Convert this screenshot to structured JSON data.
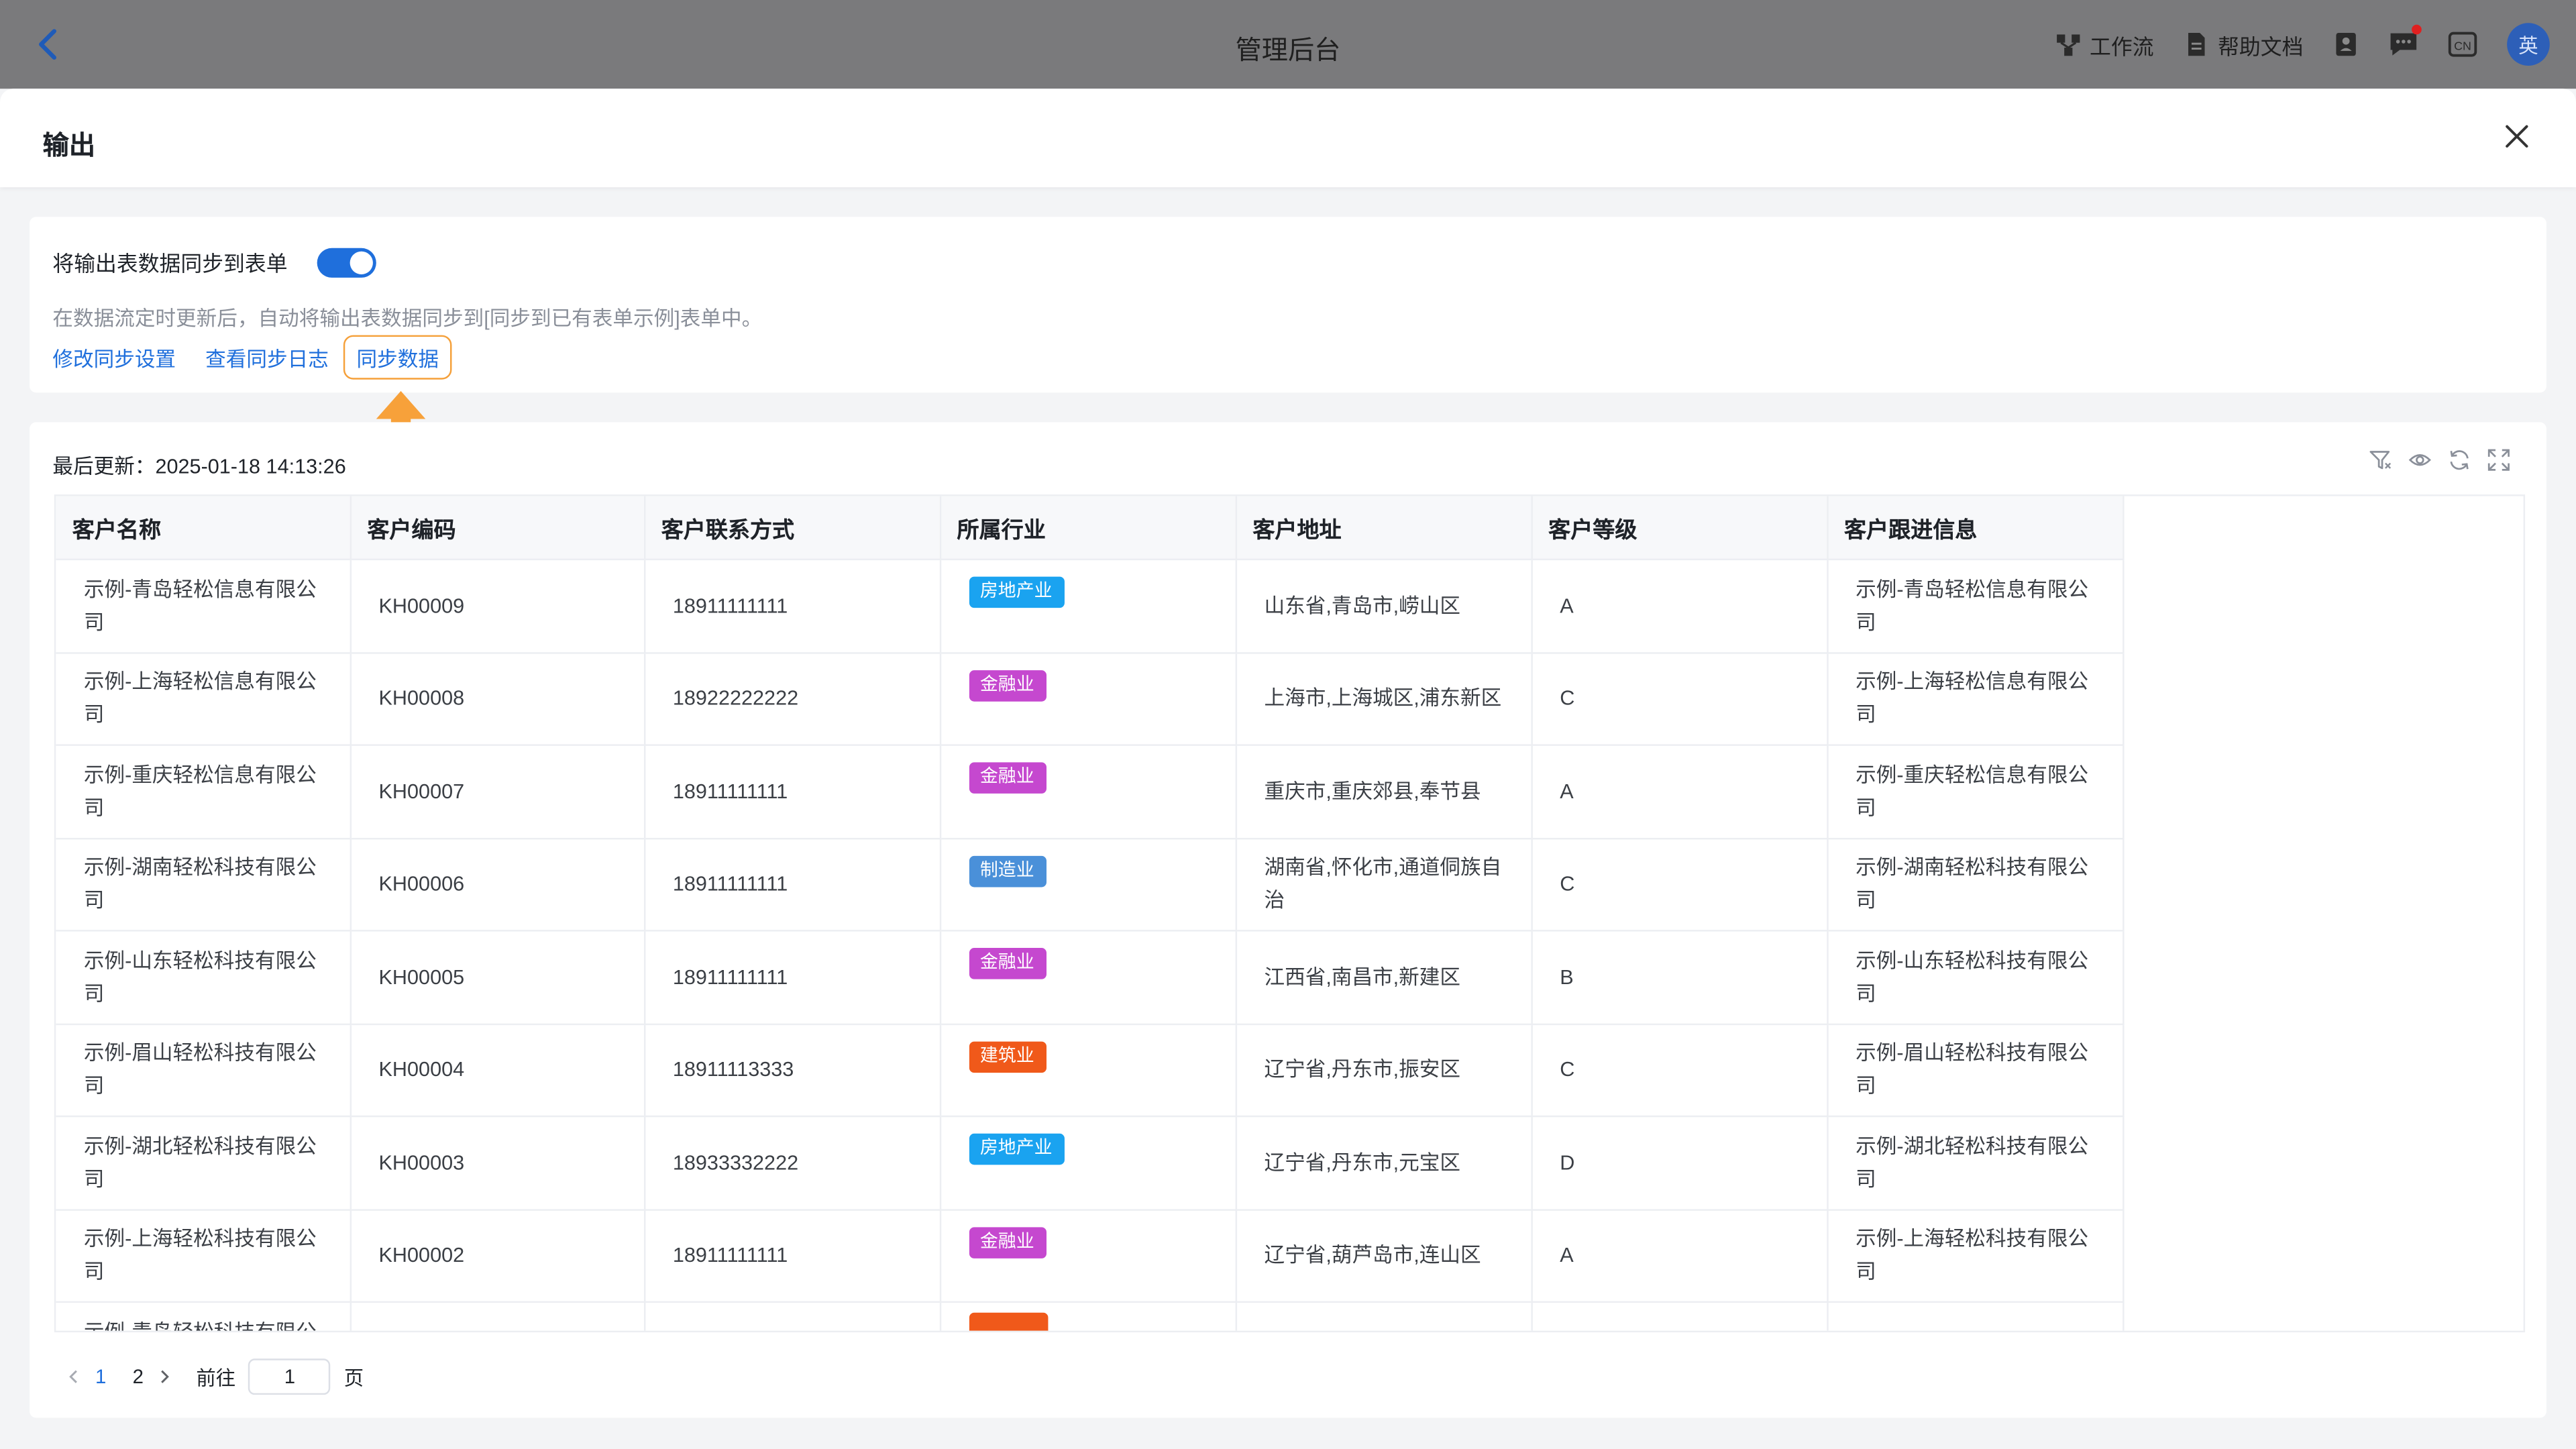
{
  "topbar": {
    "title": "管理后台",
    "workflow_label": "工作流",
    "help_label": "帮助文档",
    "lang_badge": "CN",
    "avatar_text": "英"
  },
  "modal": {
    "title": "输出"
  },
  "sync": {
    "toggle_label": "将输出表数据同步到表单",
    "toggle_on": true,
    "description": "在数据流定时更新后，自动将输出表数据同步到[同步到已有表单示例]表单中。",
    "edit_settings": "修改同步设置",
    "view_log": "查看同步日志",
    "sync_data": "同步数据"
  },
  "table": {
    "last_update_label": "最后更新：",
    "last_update_value": "2025-01-18 14:13:26",
    "columns": [
      "客户名称",
      "客户编码",
      "客户联系方式",
      "所属行业",
      "客户地址",
      "客户等级",
      "客户跟进信息"
    ],
    "rows": [
      {
        "name": "示例-青岛轻松信息有限公司",
        "code": "KH00009",
        "phone": "18911111111",
        "industry": "房地产业",
        "industry_color": "#1aa3f0",
        "address": "山东省,青岛市,崂山区",
        "level": "A",
        "follow": "示例-青岛轻松信息有限公司"
      },
      {
        "name": "示例-上海轻松信息有限公司",
        "code": "KH00008",
        "phone": "18922222222",
        "industry": "金融业",
        "industry_color": "#c548cf",
        "address": "上海市,上海城区,浦东新区",
        "level": "C",
        "follow": "示例-上海轻松信息有限公司"
      },
      {
        "name": "示例-重庆轻松信息有限公司",
        "code": "KH00007",
        "phone": "18911111111",
        "industry": "金融业",
        "industry_color": "#c548cf",
        "address": "重庆市,重庆郊县,奉节县",
        "level": "A",
        "follow": "示例-重庆轻松信息有限公司"
      },
      {
        "name": "示例-湖南轻松科技有限公司",
        "code": "KH00006",
        "phone": "18911111111",
        "industry": "制造业",
        "industry_color": "#4a90d9",
        "address": "湖南省,怀化市,通道侗族自治",
        "level": "C",
        "follow": "示例-湖南轻松科技有限公司"
      },
      {
        "name": "示例-山东轻松科技有限公司",
        "code": "KH00005",
        "phone": "18911111111",
        "industry": "金融业",
        "industry_color": "#c548cf",
        "address": "江西省,南昌市,新建区",
        "level": "B",
        "follow": "示例-山东轻松科技有限公司"
      },
      {
        "name": "示例-眉山轻松科技有限公司",
        "code": "KH00004",
        "phone": "18911113333",
        "industry": "建筑业",
        "industry_color": "#f0591a",
        "address": "辽宁省,丹东市,振安区",
        "level": "C",
        "follow": "示例-眉山轻松科技有限公司"
      },
      {
        "name": "示例-湖北轻松科技有限公司",
        "code": "KH00003",
        "phone": "18933332222",
        "industry": "房地产业",
        "industry_color": "#1aa3f0",
        "address": "辽宁省,丹东市,元宝区",
        "level": "D",
        "follow": "示例-湖北轻松科技有限公司"
      },
      {
        "name": "示例-上海轻松科技有限公司",
        "code": "KH00002",
        "phone": "18911111111",
        "industry": "金融业",
        "industry_color": "#c548cf",
        "address": "辽宁省,葫芦岛市,连山区",
        "level": "A",
        "follow": "示例-上海轻松科技有限公司"
      },
      {
        "name": "示例-青岛轻松科技有限公司",
        "code": "",
        "phone": "",
        "industry": "",
        "industry_color": "#f0591a",
        "address": "",
        "level": "",
        "follow": ""
      }
    ]
  },
  "pagination": {
    "pages": [
      "1",
      "2"
    ],
    "current": "1",
    "goto_label": "前往",
    "goto_value": "1",
    "page_suffix": "页"
  }
}
